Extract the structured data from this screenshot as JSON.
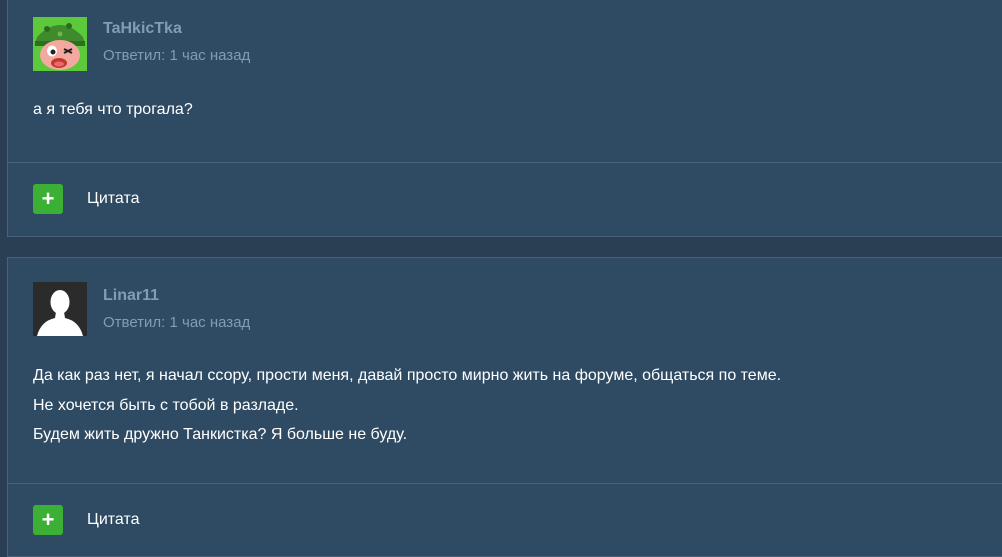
{
  "posts": [
    {
      "author": "TaHkicTka",
      "meta": "Ответил: 1 час назад",
      "avatar_icon": "cartoon-soldier-avatar",
      "content": [
        "а я тебя что трогала?"
      ],
      "quote_label": "Цитата"
    },
    {
      "author": "Linar11",
      "meta": "Ответил: 1 час назад",
      "avatar_icon": "default-user-silhouette-avatar",
      "content": [
        "Да как раз нет, я начал ссору, прости меня, давай просто мирно жить на форуме, общаться по теме.",
        "Не хочется быть с тобой в разладе.",
        "Будем жить дружно Танкистка? Я больше не буду."
      ],
      "quote_label": "Цитата"
    }
  ],
  "colors": {
    "page_bg": "#2a3f53",
    "post_bg": "#2f4b63",
    "border": "#4a6278",
    "author": "#7f9db4",
    "quote_button": "#3cb034",
    "text": "#ffffff"
  }
}
